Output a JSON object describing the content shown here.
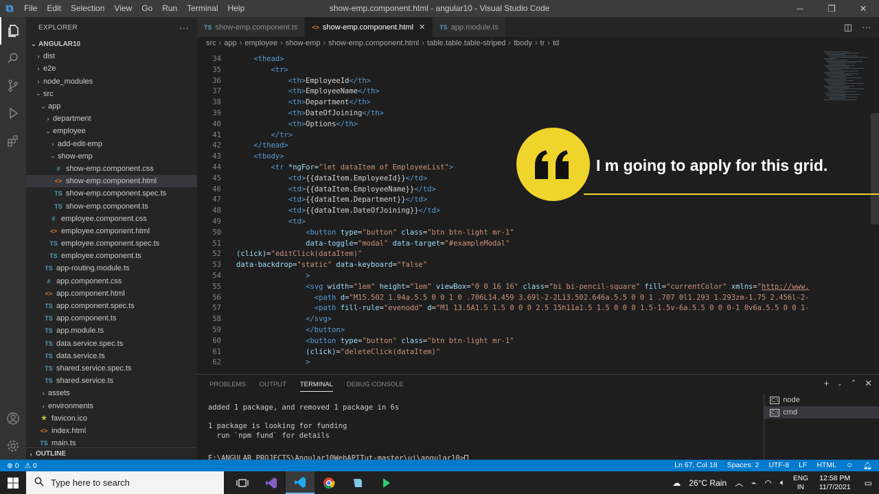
{
  "titlebar": {
    "logo": "⧉",
    "menu": [
      "File",
      "Edit",
      "Selection",
      "View",
      "Go",
      "Run",
      "Terminal",
      "Help"
    ],
    "title": "show-emp.component.html - angular10 - Visual Studio Code"
  },
  "sidebar": {
    "header": "EXPLORER",
    "more": "···",
    "root": "ANGULAR10",
    "outline": "OUTLINE",
    "items": [
      {
        "label": "dist",
        "depth": 1,
        "kind": "folder",
        "open": false
      },
      {
        "label": "e2e",
        "depth": 1,
        "kind": "folder",
        "open": false
      },
      {
        "label": "node_modules",
        "depth": 1,
        "kind": "folder",
        "open": false
      },
      {
        "label": "src",
        "depth": 1,
        "kind": "folder",
        "open": true
      },
      {
        "label": "app",
        "depth": 2,
        "kind": "folder",
        "open": true
      },
      {
        "label": "department",
        "depth": 3,
        "kind": "folder",
        "open": false
      },
      {
        "label": "employee",
        "depth": 3,
        "kind": "folder",
        "open": true
      },
      {
        "label": "add-edit-emp",
        "depth": 4,
        "kind": "folder",
        "open": false
      },
      {
        "label": "show-emp",
        "depth": 4,
        "kind": "folder",
        "open": true
      },
      {
        "label": "show-emp.component.css",
        "depth": 5,
        "kind": "css"
      },
      {
        "label": "show-emp.component.html",
        "depth": 5,
        "kind": "html",
        "selected": true
      },
      {
        "label": "show-emp.component.spec.ts",
        "depth": 5,
        "kind": "ts"
      },
      {
        "label": "show-emp.component.ts",
        "depth": 5,
        "kind": "ts"
      },
      {
        "label": "employee.component.css",
        "depth": 4,
        "kind": "css"
      },
      {
        "label": "employee.component.html",
        "depth": 4,
        "kind": "html"
      },
      {
        "label": "employee.component.spec.ts",
        "depth": 4,
        "kind": "ts"
      },
      {
        "label": "employee.component.ts",
        "depth": 4,
        "kind": "ts"
      },
      {
        "label": "app-routing.module.ts",
        "depth": 3,
        "kind": "ts"
      },
      {
        "label": "app.component.css",
        "depth": 3,
        "kind": "css"
      },
      {
        "label": "app.component.html",
        "depth": 3,
        "kind": "html"
      },
      {
        "label": "app.component.spec.ts",
        "depth": 3,
        "kind": "ts"
      },
      {
        "label": "app.component.ts",
        "depth": 3,
        "kind": "ts"
      },
      {
        "label": "app.module.ts",
        "depth": 3,
        "kind": "ts"
      },
      {
        "label": "data.service.spec.ts",
        "depth": 3,
        "kind": "ts"
      },
      {
        "label": "data.service.ts",
        "depth": 3,
        "kind": "ts"
      },
      {
        "label": "shared.service.spec.ts",
        "depth": 3,
        "kind": "ts"
      },
      {
        "label": "shared.service.ts",
        "depth": 3,
        "kind": "ts"
      },
      {
        "label": "assets",
        "depth": 2,
        "kind": "folder",
        "open": false
      },
      {
        "label": "environments",
        "depth": 2,
        "kind": "folder",
        "open": false
      },
      {
        "label": "favicon.ico",
        "depth": 2,
        "kind": "fav"
      },
      {
        "label": "index.html",
        "depth": 2,
        "kind": "html"
      },
      {
        "label": "main.ts",
        "depth": 2,
        "kind": "ts"
      }
    ]
  },
  "tabs": [
    {
      "label": "show-emp.component.ts",
      "icon": "TS",
      "kind": "ts",
      "active": false
    },
    {
      "label": "show-emp.component.html",
      "icon": "<>",
      "kind": "html",
      "active": true,
      "close": "✕"
    },
    {
      "label": "app.module.ts",
      "icon": "TS",
      "kind": "ts",
      "active": false
    }
  ],
  "breadcrumb": [
    "src",
    "app",
    "employee",
    "show-emp",
    "show-emp.component.html",
    "table.table.table-striped",
    "tbody",
    "tr",
    "td"
  ],
  "editor": {
    "lines": [
      {
        "n": "34",
        "t": [
          [
            "    ",
            "p"
          ],
          [
            "<thead>",
            "tag"
          ]
        ]
      },
      {
        "n": "35",
        "t": [
          [
            "        ",
            "p"
          ],
          [
            "<tr>",
            "tag"
          ]
        ]
      },
      {
        "n": "36",
        "t": [
          [
            "            ",
            "p"
          ],
          [
            "<th>",
            "tag"
          ],
          [
            "EmployeeId",
            "p"
          ],
          [
            "</th>",
            "tag"
          ]
        ]
      },
      {
        "n": "37",
        "t": [
          [
            "            ",
            "p"
          ],
          [
            "<th>",
            "tag"
          ],
          [
            "EmployeeName",
            "p"
          ],
          [
            "</th>",
            "tag"
          ]
        ]
      },
      {
        "n": "38",
        "t": [
          [
            "            ",
            "p"
          ],
          [
            "<th>",
            "tag"
          ],
          [
            "Department",
            "p"
          ],
          [
            "</th>",
            "tag"
          ]
        ]
      },
      {
        "n": "39",
        "t": [
          [
            "            ",
            "p"
          ],
          [
            "<th>",
            "tag"
          ],
          [
            "DateOfJoining",
            "p"
          ],
          [
            "</th>",
            "tag"
          ]
        ]
      },
      {
        "n": "40",
        "t": [
          [
            "            ",
            "p"
          ],
          [
            "<th>",
            "tag"
          ],
          [
            "Options",
            "p"
          ],
          [
            "</th>",
            "tag"
          ]
        ]
      },
      {
        "n": "41",
        "t": [
          [
            "        ",
            "p"
          ],
          [
            "</tr>",
            "tag"
          ]
        ]
      },
      {
        "n": "42",
        "t": [
          [
            "    ",
            "p"
          ],
          [
            "</thead>",
            "tag"
          ]
        ]
      },
      {
        "n": "43",
        "t": [
          [
            "    ",
            "p"
          ],
          [
            "<tbody>",
            "tag"
          ]
        ]
      },
      {
        "n": "44",
        "t": [
          [
            "        ",
            "p"
          ],
          [
            "<tr ",
            "tag"
          ],
          [
            "*ngFor",
            "attr"
          ],
          [
            "=",
            "p"
          ],
          [
            "\"let dataItem of EmployeeList\"",
            "str"
          ],
          [
            ">",
            "tag"
          ]
        ]
      },
      {
        "n": "45",
        "t": [
          [
            "            ",
            "p"
          ],
          [
            "<td>",
            "tag"
          ],
          [
            "{{dataItem.EmployeeId}}",
            "p"
          ],
          [
            "</td>",
            "tag"
          ]
        ]
      },
      {
        "n": "46",
        "t": [
          [
            "            ",
            "p"
          ],
          [
            "<td>",
            "tag"
          ],
          [
            "{{dataItem.EmployeeName}}",
            "p"
          ],
          [
            "</td>",
            "tag"
          ]
        ]
      },
      {
        "n": "47",
        "t": [
          [
            "            ",
            "p"
          ],
          [
            "<td>",
            "tag"
          ],
          [
            "{{dataItem.Department}}",
            "p"
          ],
          [
            "</td>",
            "tag"
          ]
        ]
      },
      {
        "n": "48",
        "t": [
          [
            "            ",
            "p"
          ],
          [
            "<td>",
            "tag"
          ],
          [
            "{{dataItem.DateOfJoining}}",
            "p"
          ],
          [
            "</td>",
            "tag"
          ]
        ]
      },
      {
        "n": "49",
        "t": [
          [
            "            ",
            "p"
          ],
          [
            "<td>",
            "tag"
          ]
        ]
      },
      {
        "n": "50",
        "t": [
          [
            "                ",
            "p"
          ],
          [
            "<button ",
            "tag"
          ],
          [
            "type",
            "attr"
          ],
          [
            "=",
            "p"
          ],
          [
            "\"button\"",
            "str"
          ],
          [
            " class",
            "attr"
          ],
          [
            "=",
            "p"
          ],
          [
            "\"btn btn-light mr-1\"",
            "str"
          ]
        ]
      },
      {
        "n": "51",
        "t": [
          [
            "                ",
            "p"
          ],
          [
            "data-toggle",
            "attr"
          ],
          [
            "=",
            "p"
          ],
          [
            "\"modal\"",
            "str"
          ],
          [
            " data-target",
            "attr"
          ],
          [
            "=",
            "p"
          ],
          [
            "\"#exampleModal\"",
            "str"
          ]
        ]
      },
      {
        "n": "52",
        "t": [
          [
            "(click)",
            "attr"
          ],
          [
            "=",
            "p"
          ],
          [
            "\"editClick(dataItem)\"",
            "str"
          ]
        ]
      },
      {
        "n": "53",
        "t": [
          [
            "data-backdrop",
            "attr"
          ],
          [
            "=",
            "p"
          ],
          [
            "\"static\"",
            "str"
          ],
          [
            " data-keyboard",
            "attr"
          ],
          [
            "=",
            "p"
          ],
          [
            "\"false\"",
            "str"
          ]
        ]
      },
      {
        "n": "54",
        "t": [
          [
            "                ",
            "p"
          ],
          [
            ">",
            "tag"
          ]
        ]
      },
      {
        "n": "55",
        "t": [
          [
            "                ",
            "p"
          ],
          [
            "<svg ",
            "tag"
          ],
          [
            "width",
            "attr"
          ],
          [
            "=",
            "p"
          ],
          [
            "\"1em\"",
            "str"
          ],
          [
            " height",
            "attr"
          ],
          [
            "=",
            "p"
          ],
          [
            "\"1em\"",
            "str"
          ],
          [
            " viewBox",
            "attr"
          ],
          [
            "=",
            "p"
          ],
          [
            "\"0 0 16 16\"",
            "str"
          ],
          [
            " class",
            "attr"
          ],
          [
            "=",
            "p"
          ],
          [
            "\"bi bi-pencil-square\"",
            "str"
          ],
          [
            " fill",
            "attr"
          ],
          [
            "=",
            "p"
          ],
          [
            "\"currentColor\"",
            "str"
          ],
          [
            " xmlns",
            "attr"
          ],
          [
            "=",
            "p"
          ],
          [
            "\"",
            "str"
          ],
          [
            "http://www.",
            "link"
          ]
        ]
      },
      {
        "n": "56",
        "t": [
          [
            "                  ",
            "p"
          ],
          [
            "<path ",
            "tag"
          ],
          [
            "d",
            "attr"
          ],
          [
            "=",
            "p"
          ],
          [
            "\"M15.502 1.94a.5.5 0 0 1 0 .706L14.459 3.69l-2-2L13.502.646a.5.5 0 0 1 .707 0l1.293 1.293zm-1.75 2.456l-2-",
            "str"
          ]
        ]
      },
      {
        "n": "57",
        "t": [
          [
            "                  ",
            "p"
          ],
          [
            "<path ",
            "tag"
          ],
          [
            "fill-rule",
            "attr"
          ],
          [
            "=",
            "p"
          ],
          [
            "\"evenodd\"",
            "str"
          ],
          [
            " d",
            "attr"
          ],
          [
            "=",
            "p"
          ],
          [
            "\"M1 13.5A1.5 1.5 0 0 0 2.5 15h11a1.5 1.5 0 0 0 1.5-1.5v-6a.5.5 0 0 0-1 0v6a.5.5 0 0 1-",
            "str"
          ]
        ]
      },
      {
        "n": "58",
        "t": [
          [
            "                ",
            "p"
          ],
          [
            "</svg>",
            "tag"
          ]
        ]
      },
      {
        "n": "59",
        "t": [
          [
            "                ",
            "p"
          ],
          [
            "</button>",
            "tag"
          ]
        ]
      },
      {
        "n": "60",
        "t": [
          [
            "                ",
            "p"
          ],
          [
            "<button ",
            "tag"
          ],
          [
            "type",
            "attr"
          ],
          [
            "=",
            "p"
          ],
          [
            "\"button\"",
            "str"
          ],
          [
            " class",
            "attr"
          ],
          [
            "=",
            "p"
          ],
          [
            "\"btn btn-light mr-1\"",
            "str"
          ]
        ]
      },
      {
        "n": "61",
        "t": [
          [
            "                ",
            "p"
          ],
          [
            "(click)",
            "attr"
          ],
          [
            "=",
            "p"
          ],
          [
            "\"deleteClick(dataItem)\"",
            "str"
          ]
        ]
      },
      {
        "n": "62",
        "t": [
          [
            "                ",
            "p"
          ],
          [
            ">",
            "tag"
          ]
        ]
      }
    ]
  },
  "quote": {
    "mark": "❝",
    "text": "I m going to apply for this grid.",
    "color": "#efd42b"
  },
  "panel": {
    "tabs": [
      "PROBLEMS",
      "OUTPUT",
      "TERMINAL",
      "DEBUG CONSOLE"
    ],
    "active_tab": "TERMINAL",
    "terminal_lines": [
      "added 1 package, and removed 1 package in 6s",
      "",
      "1 package is looking for funding",
      "  run `npm fund` for details",
      "",
      "E:\\ANGULAR PROJECTS\\Angular10WebAPITut-master\\ui\\angular10>"
    ],
    "terminals": [
      {
        "label": "node",
        "active": false
      },
      {
        "label": "cmd",
        "active": true
      }
    ]
  },
  "statusbar": {
    "errors": "⊗ 0",
    "warnings": "⚠ 0",
    "position": "Ln 67, Col 18",
    "spaces": "Spaces: 2",
    "encoding": "UTF-8",
    "eol": "LF",
    "language": "HTML",
    "accent": "#007acc"
  },
  "taskbar": {
    "search_placeholder": "Type here to search",
    "weather": "26°C Rain",
    "lang_top": "ENG",
    "lang_bottom": "IN",
    "time": "12:58 PM",
    "date": "11/7/2021"
  },
  "colors": {
    "tag": "#569cd6",
    "attr": "#9cdcfe",
    "str": "#ce9178",
    "link": "#ce9178"
  }
}
